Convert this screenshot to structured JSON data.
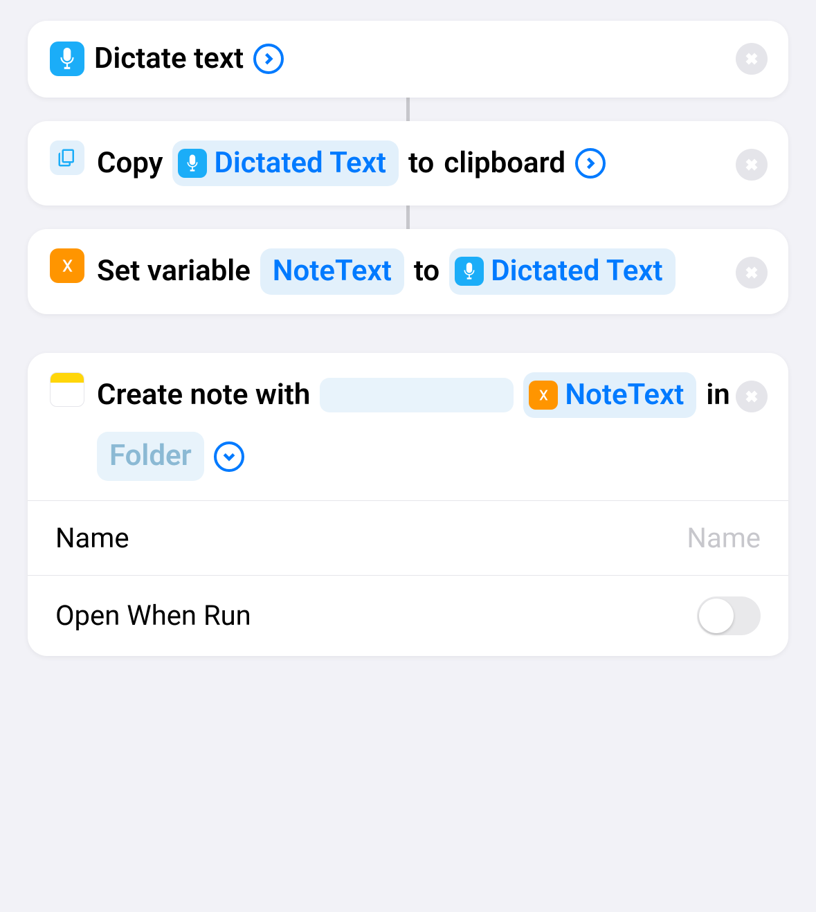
{
  "actions": {
    "dictate": {
      "title": "Dictate text"
    },
    "copy": {
      "prefix": "Copy",
      "token_label": "Dictated Text",
      "middle": "to",
      "suffix": "clipboard"
    },
    "setvar": {
      "prefix": "Set variable",
      "var_name": "NoteText",
      "middle": "to",
      "source_label": "Dictated Text"
    },
    "createnote": {
      "prefix": "Create note with",
      "var_token": "NoteText",
      "in_word": "in",
      "folder_placeholder": "Folder",
      "params": {
        "name_label": "Name",
        "name_placeholder": "Name",
        "open_label": "Open When Run"
      }
    }
  }
}
